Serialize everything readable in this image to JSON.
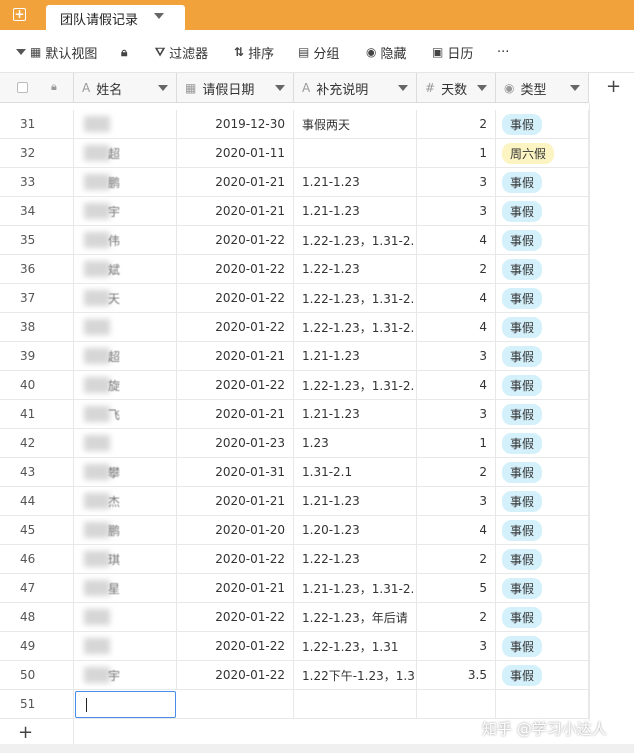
{
  "tab": {
    "title": "团队请假记录"
  },
  "toolbar": {
    "view": "默认视图",
    "filter": "过滤器",
    "sort": "排序",
    "group": "分组",
    "hide": "隐藏",
    "calendar": "日历",
    "more": "···"
  },
  "columns": {
    "name": "姓名",
    "date": "请假日期",
    "note": "补充说明",
    "days": "天数",
    "type": "类型"
  },
  "icons": {
    "add_tab": "plus-square-icon",
    "view": "grid-view-icon",
    "lock": "lock-icon",
    "filter": "filter-icon",
    "sort": "sort-icon",
    "group": "group-icon",
    "hide": "eye-icon",
    "calendar": "calendar-icon",
    "more": "more-icon"
  },
  "colors": {
    "tabbar": "#f2a23a",
    "badge_blue": "#d4f1fb",
    "badge_yellow": "#fcf5c3",
    "edit_border": "#4a8de8"
  },
  "rows": [
    {
      "num": "31",
      "name": "",
      "date": "2019-12-30",
      "note": "事假两天",
      "days": "2",
      "type": "事假",
      "color": "blue"
    },
    {
      "num": "32",
      "name": "超",
      "date": "2020-01-11",
      "note": "",
      "days": "1",
      "type": "周六假",
      "color": "yellow"
    },
    {
      "num": "33",
      "name": "鹏",
      "date": "2020-01-21",
      "note": "1.21-1.23",
      "days": "3",
      "type": "事假",
      "color": "blue"
    },
    {
      "num": "34",
      "name": "宇",
      "date": "2020-01-21",
      "note": "1.21-1.23",
      "days": "3",
      "type": "事假",
      "color": "blue"
    },
    {
      "num": "35",
      "name": "伟",
      "date": "2020-01-22",
      "note": "1.22-1.23，1.31-2.",
      "days": "4",
      "type": "事假",
      "color": "blue"
    },
    {
      "num": "36",
      "name": "斌",
      "date": "2020-01-22",
      "note": "1.22-1.23",
      "days": "2",
      "type": "事假",
      "color": "blue"
    },
    {
      "num": "37",
      "name": "天",
      "date": "2020-01-22",
      "note": "1.22-1.23，1.31-2.",
      "days": "4",
      "type": "事假",
      "color": "blue"
    },
    {
      "num": "38",
      "name": "",
      "date": "2020-01-22",
      "note": "1.22-1.23，1.31-2.",
      "days": "4",
      "type": "事假",
      "color": "blue"
    },
    {
      "num": "39",
      "name": "超",
      "date": "2020-01-21",
      "note": "1.21-1.23",
      "days": "3",
      "type": "事假",
      "color": "blue"
    },
    {
      "num": "40",
      "name": "旋",
      "date": "2020-01-22",
      "note": "1.22-1.23，1.31-2.",
      "days": "4",
      "type": "事假",
      "color": "blue"
    },
    {
      "num": "41",
      "name": "飞",
      "date": "2020-01-21",
      "note": "1.21-1.23",
      "days": "3",
      "type": "事假",
      "color": "blue"
    },
    {
      "num": "42",
      "name": "",
      "date": "2020-01-23",
      "note": "1.23",
      "days": "1",
      "type": "事假",
      "color": "blue"
    },
    {
      "num": "43",
      "name": "攀",
      "date": "2020-01-31",
      "note": "1.31-2.1",
      "days": "2",
      "type": "事假",
      "color": "blue"
    },
    {
      "num": "44",
      "name": "杰",
      "date": "2020-01-21",
      "note": "1.21-1.23",
      "days": "3",
      "type": "事假",
      "color": "blue"
    },
    {
      "num": "45",
      "name": "鹏",
      "date": "2020-01-20",
      "note": "1.20-1.23",
      "days": "4",
      "type": "事假",
      "color": "blue"
    },
    {
      "num": "46",
      "name": "琪",
      "date": "2020-01-22",
      "note": "1.22-1.23",
      "days": "2",
      "type": "事假",
      "color": "blue"
    },
    {
      "num": "47",
      "name": "星",
      "date": "2020-01-21",
      "note": "1.21-1.23，1.31-2.",
      "days": "5",
      "type": "事假",
      "color": "blue"
    },
    {
      "num": "48",
      "name": "",
      "date": "2020-01-22",
      "note": "1.22-1.23，年后请",
      "days": "2",
      "type": "事假",
      "color": "blue"
    },
    {
      "num": "49",
      "name": "",
      "date": "2020-01-22",
      "note": "1.22-1.23，1.31",
      "days": "3",
      "type": "事假",
      "color": "blue"
    },
    {
      "num": "50",
      "name": "宇",
      "date": "2020-01-22",
      "note": "1.22下午-1.23，1.3",
      "days": "3.5",
      "type": "事假",
      "color": "blue"
    }
  ],
  "new_row": {
    "num": "51"
  },
  "add_row_label": "+",
  "add_col_label": "+",
  "watermark": "知乎 @学习小达人"
}
